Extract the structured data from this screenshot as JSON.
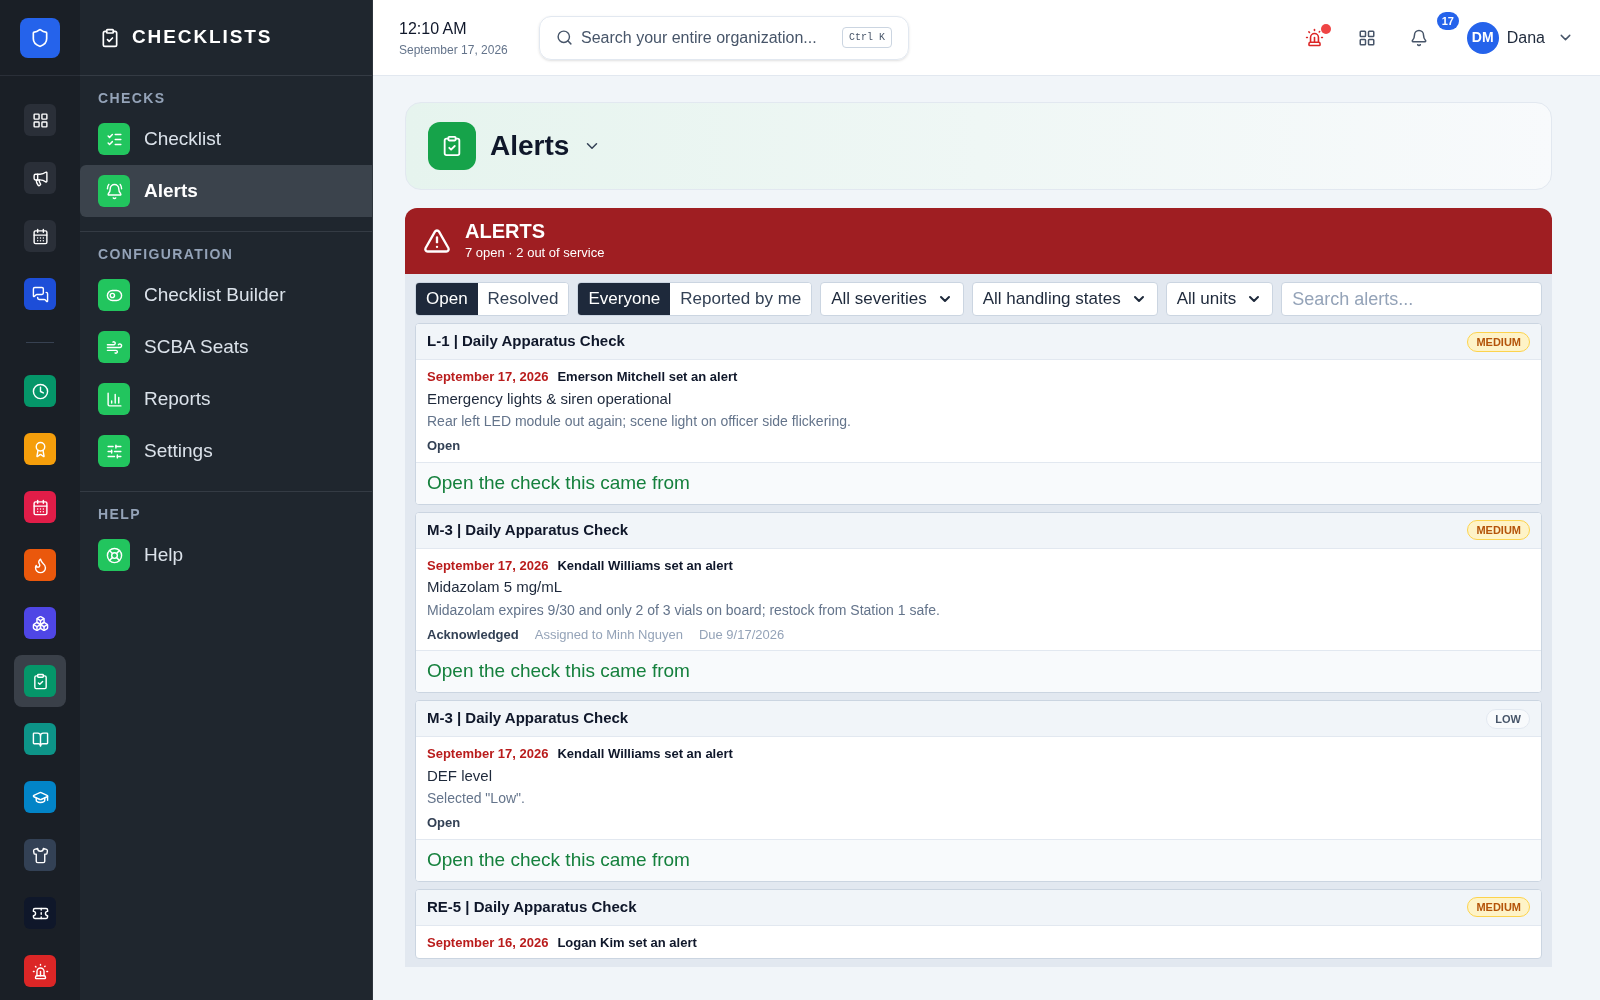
{
  "rail": {
    "top": [
      {
        "kind": "grid",
        "color": "#2a2f38",
        "selected": false
      },
      {
        "kind": "megaphone",
        "color": "#2a2f38",
        "selected": false
      },
      {
        "kind": "calendar",
        "color": "#2a2f38",
        "selected": false
      },
      {
        "kind": "chat",
        "color": "#1d4ed8",
        "selected": false
      }
    ],
    "bottom": [
      {
        "kind": "clock",
        "color": "#059669",
        "selected": false
      },
      {
        "kind": "award",
        "color": "#f59e0b",
        "selected": false
      },
      {
        "kind": "calendar",
        "color": "#e11d48",
        "selected": false
      },
      {
        "kind": "flame",
        "color": "#ea580c",
        "selected": false
      },
      {
        "kind": "boxes",
        "color": "#4f46e5",
        "selected": false
      },
      {
        "kind": "clipboard",
        "color": "#059669",
        "selected": true
      },
      {
        "kind": "book",
        "color": "#0d9488",
        "selected": false
      },
      {
        "kind": "cap",
        "color": "#0284c7",
        "selected": false
      },
      {
        "kind": "shirt",
        "color": "#334155",
        "selected": false
      },
      {
        "kind": "ticket",
        "color": "#0f172a",
        "selected": false
      },
      {
        "kind": "siren",
        "color": "#dc2626",
        "selected": false
      }
    ]
  },
  "sidebar": {
    "title": "CHECKLISTS",
    "sections": [
      {
        "heading": "CHECKS",
        "items": [
          {
            "label": "Checklist",
            "kind": "list",
            "selected": false
          },
          {
            "label": "Alerts",
            "kind": "bell",
            "selected": true
          }
        ]
      },
      {
        "heading": "CONFIGURATION",
        "items": [
          {
            "label": "Checklist Builder",
            "kind": "toggles",
            "selected": false
          },
          {
            "label": "SCBA Seats",
            "kind": "wind",
            "selected": false
          },
          {
            "label": "Reports",
            "kind": "chart",
            "selected": false
          },
          {
            "label": "Settings",
            "kind": "sliders",
            "selected": false
          }
        ]
      },
      {
        "heading": "HELP",
        "items": [
          {
            "label": "Help",
            "kind": "lifebuoy",
            "selected": false
          }
        ]
      }
    ]
  },
  "topbar": {
    "time": "12:10 AM",
    "date": "September 17, 2026",
    "search": {
      "placeholder": "Search your entire organization...",
      "shortcut": "Ctrl K"
    },
    "alarm_dot": true,
    "notifications": "17",
    "user": {
      "initials": "DM",
      "name": "Dana"
    }
  },
  "page_header": {
    "title": "Alerts"
  },
  "alerts_banner": {
    "title": "ALERTS",
    "subtitle": "7 open · 2 out of service"
  },
  "filters": {
    "status_tabs": [
      {
        "label": "Open",
        "selected": true
      },
      {
        "label": "Resolved",
        "selected": false
      }
    ],
    "reporter_tabs": [
      {
        "label": "Everyone",
        "selected": true
      },
      {
        "label": "Reported by me",
        "selected": false
      }
    ],
    "selects": [
      "All severities",
      "All handling states",
      "All units"
    ],
    "search": {
      "placeholder": "Search alerts..."
    }
  },
  "alerts": [
    {
      "title": "L-1 | Daily Apparatus Check",
      "severity": "MEDIUM",
      "kind": "medium",
      "date": "September 17, 2026",
      "reporter": "Emerson Mitchell set an alert",
      "item": "Emergency lights & siren operational",
      "note": "Rear left LED module out again; scene light on officer side flickering.",
      "state": "Open",
      "link": "Open the check this came from"
    },
    {
      "title": "M-3 | Daily Apparatus Check",
      "severity": "MEDIUM",
      "kind": "medium",
      "date": "September 17, 2026",
      "reporter": "Kendall Williams set an alert",
      "item": "Midazolam 5 mg/mL",
      "note": "Midazolam expires 9/30 and only 2 of 3 vials on board; restock from Station 1 safe.",
      "state": "Acknowledged",
      "assigned": "Assigned to Minh Nguyen",
      "due": "Due 9/17/2026",
      "link": "Open the check this came from"
    },
    {
      "title": "M-3 | Daily Apparatus Check",
      "severity": "LOW",
      "kind": "low",
      "date": "September 17, 2026",
      "reporter": "Kendall Williams set an alert",
      "item": "DEF level",
      "note": "Selected \"Low\".",
      "state": "Open",
      "link": "Open the check this came from"
    },
    {
      "title": "RE-5 | Daily Apparatus Check",
      "severity": "MEDIUM",
      "kind": "medium",
      "date": "September 16, 2026",
      "reporter": "Logan Kim set an alert"
    }
  ]
}
